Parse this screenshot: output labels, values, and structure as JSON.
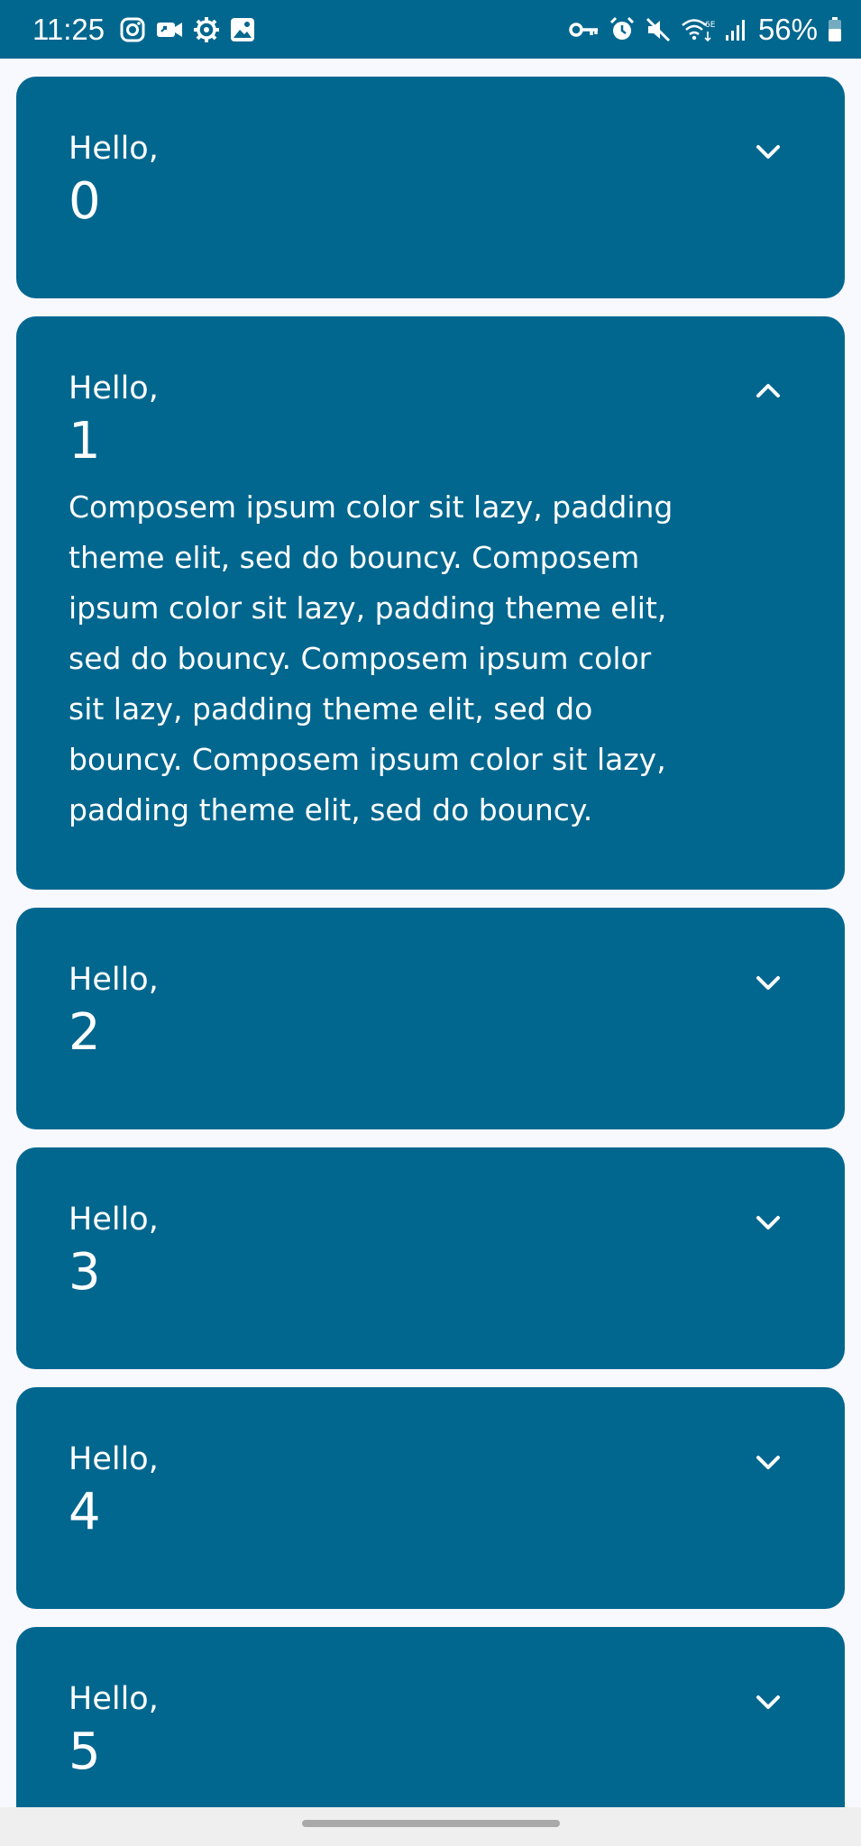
{
  "status_bar": {
    "time": "11:25",
    "left_icons": [
      "instagram-icon",
      "video-call-icon",
      "settings-gear-icon",
      "gallery-icon"
    ],
    "right_icons": [
      "vpn-key-icon",
      "alarm-icon",
      "mute-icon",
      "wifi-6e-icon",
      "signal-icon"
    ],
    "battery": "56%"
  },
  "colors": {
    "card": "#02678f",
    "background": "#f8f8ff",
    "text": "#ffffff"
  },
  "cards": [
    {
      "greeting": "Hello,",
      "number": "0",
      "expanded": false,
      "chevron": "chevron-down-icon"
    },
    {
      "greeting": "Hello,",
      "number": "1",
      "expanded": true,
      "chevron": "chevron-up-icon",
      "body": "Composem ipsum color sit lazy, padding theme elit, sed do bouncy. Composem ipsum color sit lazy, padding theme elit, sed do bouncy. Composem ipsum color sit lazy, padding theme elit, sed do bouncy. Composem ipsum color sit lazy, padding theme elit, sed do bouncy."
    },
    {
      "greeting": "Hello,",
      "number": "2",
      "expanded": false,
      "chevron": "chevron-down-icon"
    },
    {
      "greeting": "Hello,",
      "number": "3",
      "expanded": false,
      "chevron": "chevron-down-icon"
    },
    {
      "greeting": "Hello,",
      "number": "4",
      "expanded": false,
      "chevron": "chevron-down-icon"
    },
    {
      "greeting": "Hello,",
      "number": "5",
      "expanded": false,
      "chevron": "chevron-down-icon"
    }
  ]
}
